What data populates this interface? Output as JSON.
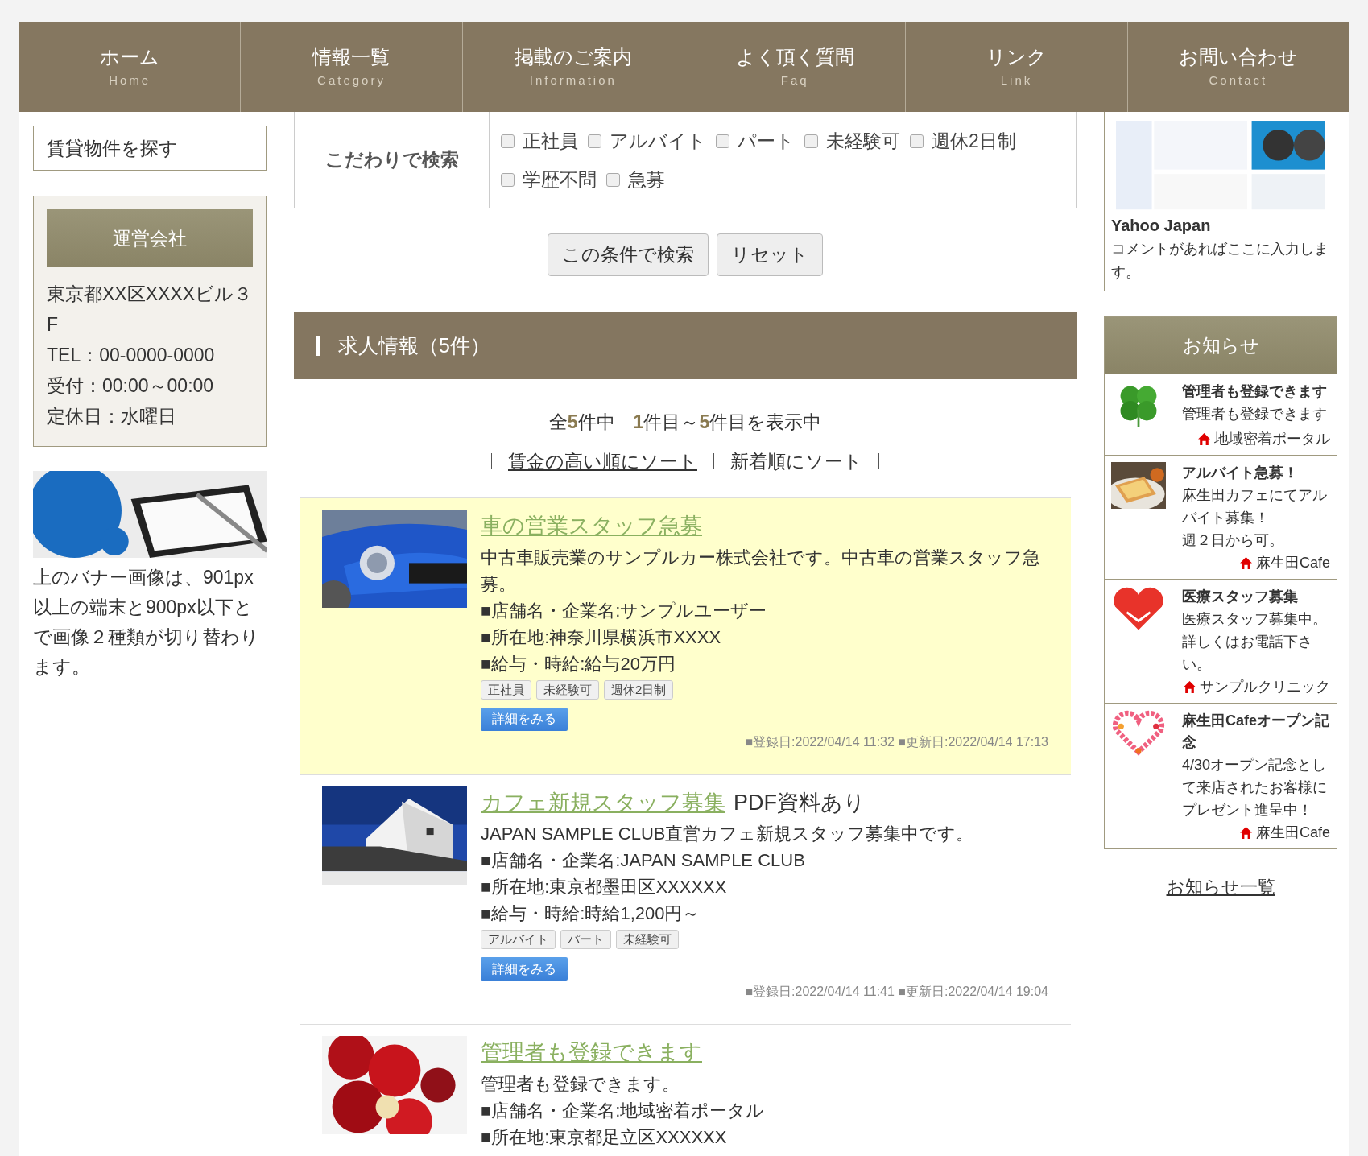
{
  "nav": [
    {
      "label": "ホーム",
      "sub": "Home"
    },
    {
      "label": "情報一覧",
      "sub": "Category"
    },
    {
      "label": "掲載のご案内",
      "sub": "Information"
    },
    {
      "label": "よく頂く質問",
      "sub": "Faq"
    },
    {
      "label": "リンク",
      "sub": "Link"
    },
    {
      "label": "お問い合わせ",
      "sub": "Contact"
    }
  ],
  "left": {
    "menu": [
      "賃貸物件を探す"
    ],
    "company": {
      "title": "運営会社",
      "lines": [
        "東京都XX区XXXXビル３F",
        "TEL：00-0000-0000",
        "受付：00:00～00:00",
        "定休日：水曜日"
      ]
    },
    "banner_caption": "上のバナー画像は、901px以上の端末と900px以下とで画像２種類が切り替わります。"
  },
  "search": {
    "label": "こだわりで検索",
    "options": [
      {
        "label": "正社員",
        "checked": false
      },
      {
        "label": "アルバイト",
        "checked": false
      },
      {
        "label": "パート",
        "checked": false
      },
      {
        "label": "未経験可",
        "checked": false
      },
      {
        "label": "週休2日制",
        "checked": false
      },
      {
        "label": "学歴不問",
        "checked": false
      },
      {
        "label": "急募",
        "checked": false
      }
    ],
    "buttons": [
      "この条件で検索",
      "リセット"
    ]
  },
  "results": {
    "title": "求人情報（5件）",
    "count": "全**5**件中　**1**件目～**5**件目を表示中",
    "sorts": [
      {
        "label": "賃金の高い順にソート",
        "selected": false
      },
      {
        "label": "新着順にソート",
        "selected": true
      }
    ],
    "jobs": [
      {
        "title": "車の営業スタッフ急募",
        "featured": true,
        "description": "中古車販売業のサンプルカー株式会社です。中古車の営業スタッフ急募。",
        "info": [
          "■店舗名・企業名:サンプルユーザー",
          "■所在地:神奈川県横浜市XXXX",
          "■給与・時給:給与20万円"
        ],
        "tags": [
          "正社員",
          "未経験可",
          "週休2日制"
        ],
        "button": "詳細をみる",
        "dates": "■登録日:2022/04/14 11:32 ■更新日:2022/04/14 17:13"
      },
      {
        "title": "カフェ新規スタッフ募集",
        "note": "PDF資料あり",
        "featured": false,
        "description": "JAPAN SAMPLE CLUB直営カフェ新規スタッフ募集中です。",
        "info": [
          "■店舗名・企業名:JAPAN SAMPLE CLUB",
          "■所在地:東京都墨田区XXXXXX",
          "■給与・時給:時給1,200円～"
        ],
        "tags": [
          "アルバイト",
          "パート",
          "未経験可"
        ],
        "button": "詳細をみる",
        "dates": "■登録日:2022/04/14 11:41 ■更新日:2022/04/14 19:04"
      },
      {
        "title": "管理者も登録できます",
        "featured": false,
        "description": "管理者も登録できます。",
        "info": [
          "■店舗名・企業名:地域密着ポータル",
          "■所在地:東京都足立区XXXXXX"
        ]
      }
    ]
  },
  "right": {
    "link_card": {
      "title": "Yahoo Japan",
      "comment": "コメントがあればここに入力します。"
    },
    "news": {
      "title": "お知らせ",
      "items": [
        {
          "title": "管理者も登録できます",
          "body": [
            "管理者も登録できます"
          ],
          "source": "地域密着ポータル"
        },
        {
          "title": "アルバイト急募！",
          "body": [
            "麻生田カフェにてアルバイト募集！",
            "週２日から可。"
          ],
          "source": "麻生田Cafe"
        },
        {
          "title": "医療スタッフ募集",
          "body": [
            "医療スタッフ募集中。詳しくはお電話下さい。"
          ],
          "source": "サンプルクリニック"
        },
        {
          "title": "麻生田Cafeオープン記念",
          "body": [
            "4/30オープン記念として来店されたお客様にプレゼント進呈中！"
          ],
          "source": "麻生田Cafe"
        }
      ],
      "more": "お知らせ一覧"
    }
  }
}
